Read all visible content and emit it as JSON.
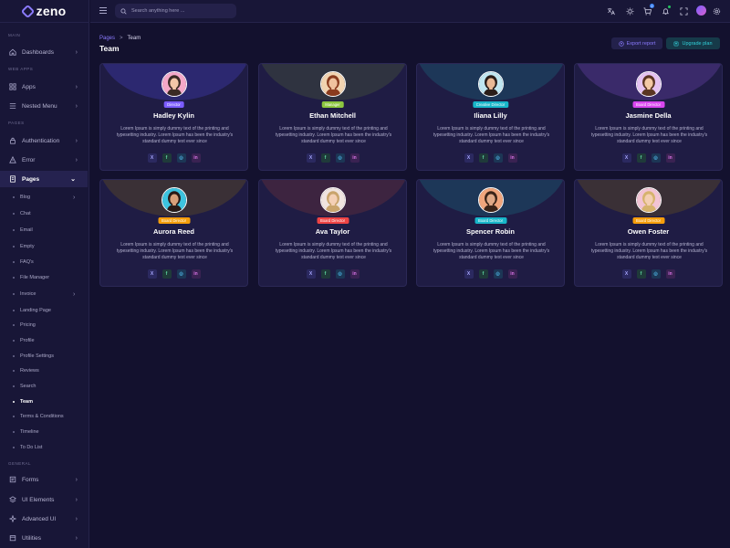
{
  "app": {
    "name": "zeno"
  },
  "header": {
    "search_placeholder": "Search anything here ...",
    "cart_badge": "2",
    "icons": [
      "translate-icon",
      "sun-icon",
      "cart-icon",
      "bell-icon",
      "fullscreen-icon",
      "flag-icon",
      "avatar",
      "settings-icon"
    ]
  },
  "sidebar": {
    "sections": {
      "main": "MAIN",
      "web_apps": "WEB APPS",
      "pages": "PAGES",
      "general": "GENERAL"
    },
    "items": {
      "dashboards": "Dashboards",
      "apps": "Apps",
      "nested_menu": "Nested Menu",
      "authentication": "Authentication",
      "error": "Error",
      "pages": "Pages",
      "forms": "Forms",
      "ui_elements": "UI Elements",
      "advanced_ui": "Advanced UI",
      "utilities": "Utilities"
    },
    "pages_sub": [
      "Blog",
      "Chat",
      "Email",
      "Empty",
      "FAQ's",
      "File Manager",
      "Invoice",
      "Landing Page",
      "Pricing",
      "Profile",
      "Profile Settings",
      "Reviews",
      "Search",
      "Team",
      "Terms & Conditions",
      "Timeline",
      "To Do List"
    ],
    "active_sub": "Team"
  },
  "breadcrumb": {
    "parent": "Pages",
    "separator": ">",
    "current": "Team"
  },
  "page_title": "Team",
  "actions": {
    "export": "Export report",
    "upgrade": "Upgrade plan"
  },
  "colors": {
    "accent": "#8b7bff",
    "upgrade": "#31d0d9",
    "background": "#13112e",
    "card": "#1f1c44"
  },
  "team": [
    {
      "name": "Hadley Kylin",
      "role": "Director",
      "role_color": "#7b5cff",
      "arc": "#2c2870",
      "avatar_bg": "#f4a8c8",
      "hair": "#3a2a24",
      "skin": "#f2c6a8"
    },
    {
      "name": "Ethan Mitchell",
      "role": "Manager",
      "role_color": "#8cc63f",
      "arc": "#2f3340",
      "avatar_bg": "#f1d3b0",
      "hair": "#8a3b1e",
      "skin": "#f0c29e"
    },
    {
      "name": "Iliana Lilly",
      "role": "Creative Director",
      "role_color": "#17b6c9",
      "arc": "#1d3758",
      "avatar_bg": "#bfe6f0",
      "hair": "#2a1d18",
      "skin": "#e9b995"
    },
    {
      "name": "Jasmine Della",
      "role": "Board Director",
      "role_color": "#d946ef",
      "arc": "#3a2a6a",
      "avatar_bg": "#e5c3f2",
      "hair": "#5a3522",
      "skin": "#f3c9a5"
    },
    {
      "name": "Aurora Reed",
      "role": "Board Director",
      "role_color": "#f59e0b",
      "arc": "#3a3036",
      "avatar_bg": "#3dc3df",
      "hair": "#2a1a16",
      "skin": "#d9a07a"
    },
    {
      "name": "Ava Taylor",
      "role": "Board Director",
      "role_color": "#ef4444",
      "arc": "#3d2440",
      "avatar_bg": "#f0e4df",
      "hair": "#c9a46c",
      "skin": "#f4d0b6"
    },
    {
      "name": "Spencer Robin",
      "role": "Board Director",
      "role_color": "#17b6c9",
      "arc": "#1d3758",
      "avatar_bg": "#f0a57c",
      "hair": "#3b2418",
      "skin": "#e0a987"
    },
    {
      "name": "Owen Foster",
      "role": "Board Director",
      "role_color": "#f59e0b",
      "arc": "#3a3036",
      "avatar_bg": "#f2c4d4",
      "hair": "#d6b36d",
      "skin": "#f4cfb2"
    }
  ],
  "card_description": "Lorem Ipsum is simply dummy text of the printing and typesetting industry. Lorem Ipsum has been the industry's standard dummy text ever since",
  "socials": [
    {
      "icon": "x-icon",
      "glyph": "X"
    },
    {
      "icon": "facebook-icon",
      "glyph": "f"
    },
    {
      "icon": "instagram-icon",
      "glyph": "◎"
    },
    {
      "icon": "linkedin-icon",
      "glyph": "in"
    }
  ]
}
